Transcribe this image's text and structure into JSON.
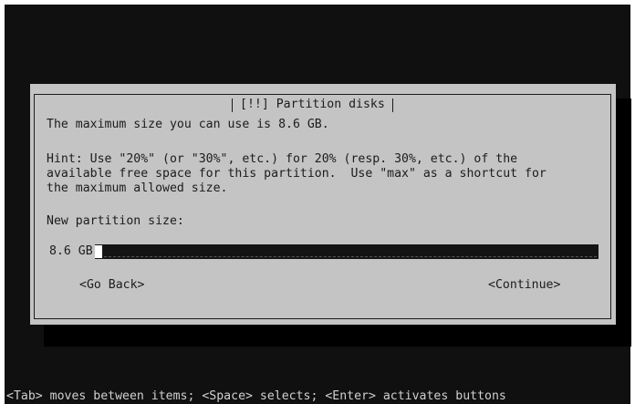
{
  "dialog": {
    "title": "[!!] Partition disks",
    "max_size_text": "The maximum size you can use is 8.6 GB.",
    "hint_lines": [
      "Hint: Use \"20%\" (or \"30%\", etc.) for 20% (resp. 30%, etc.) of the",
      "available free space for this partition.  Use \"max\" as a shortcut for",
      "the maximum allowed size."
    ],
    "field_label": "New partition size:",
    "field_value": "8.6 GB",
    "back_label": "<Go Back>",
    "continue_label": "<Continue>"
  },
  "status_bar": {
    "text": "<Tab> moves between items; <Space> selects; <Enter> activates buttons"
  }
}
